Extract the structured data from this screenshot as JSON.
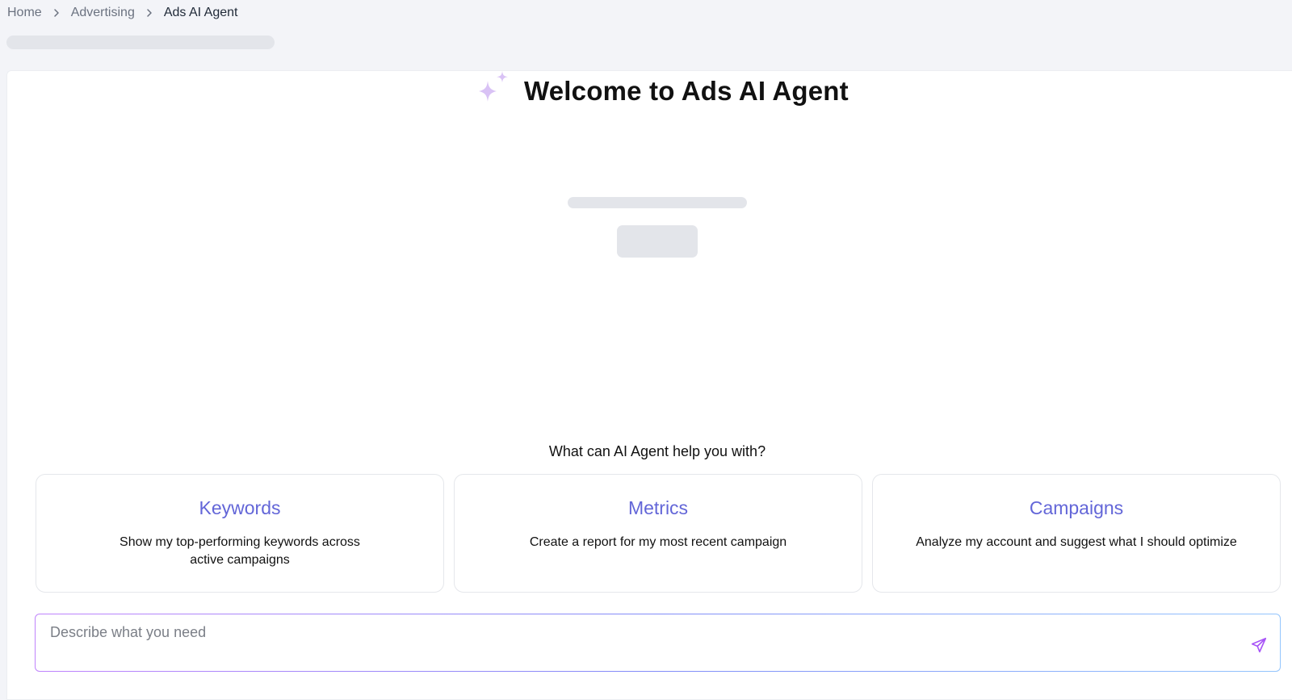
{
  "breadcrumb": {
    "items": [
      {
        "label": "Home"
      },
      {
        "label": "Advertising"
      },
      {
        "label": "Ads AI Agent"
      }
    ]
  },
  "hero": {
    "title": "Welcome to Ads AI Agent",
    "icon": "sparkle-icon",
    "accent_color": "#d9c2f5"
  },
  "help": {
    "heading": "What can AI Agent help you with?",
    "cards": [
      {
        "title": "Keywords",
        "description": "Show my top-performing keywords across active campaigns"
      },
      {
        "title": "Metrics",
        "description": "Create a report for my most recent campaign"
      },
      {
        "title": "Campaigns",
        "description": "Analyze my account and suggest what I should optimize"
      }
    ],
    "title_color": "#6366d8"
  },
  "prompt": {
    "placeholder": "Describe what you need",
    "value": "",
    "send_icon": "send-icon"
  }
}
